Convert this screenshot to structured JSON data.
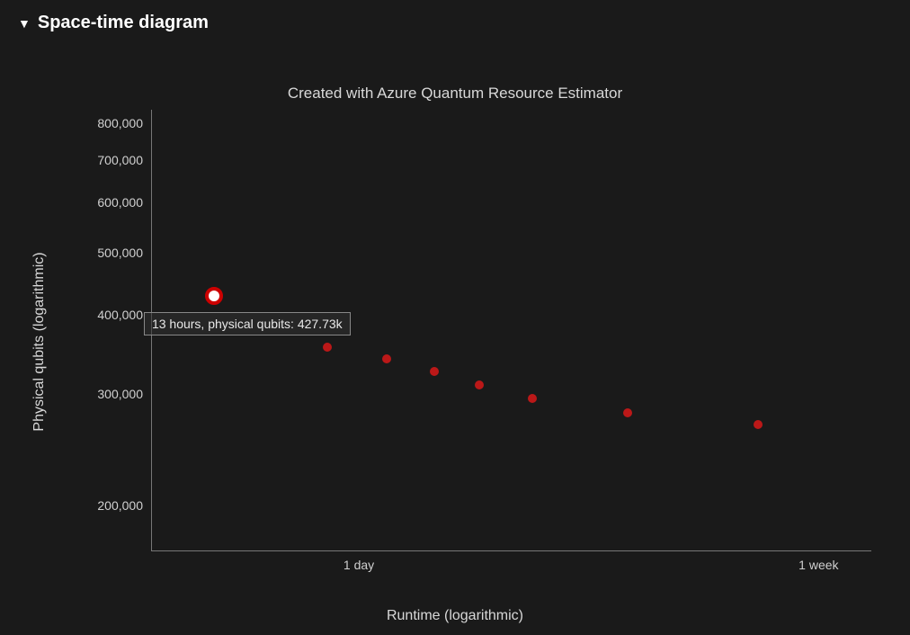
{
  "header": {
    "toggle_icon": "▼",
    "title": "Space-time diagram"
  },
  "chart_data": {
    "type": "scatter",
    "title": "Created with Azure Quantum Resource Estimator",
    "xlabel": "Runtime (logarithmic)",
    "ylabel": "Physical qubits (logarithmic)",
    "y_ticks": [
      200000,
      300000,
      400000,
      500000,
      600000,
      700000,
      800000
    ],
    "y_tick_labels": [
      "200,000",
      "300,000",
      "400,000",
      "500,000",
      "600,000",
      "700,000",
      "800,000"
    ],
    "x_scale": "log_hours",
    "x_ticks_hours": [
      24,
      168
    ],
    "x_tick_labels": [
      "1 day",
      "1 week"
    ],
    "series": [
      {
        "name": "points",
        "x_hours": [
          13,
          21,
          27,
          33,
          40,
          50,
          75,
          130
        ],
        "physical_qubits": [
          427730,
          355000,
          340000,
          325000,
          310000,
          295000,
          280000,
          268000
        ],
        "highlight_index": 0
      }
    ],
    "tooltip": {
      "text": "13 hours, physical qubits: 427.73k",
      "for_index": 0
    }
  }
}
